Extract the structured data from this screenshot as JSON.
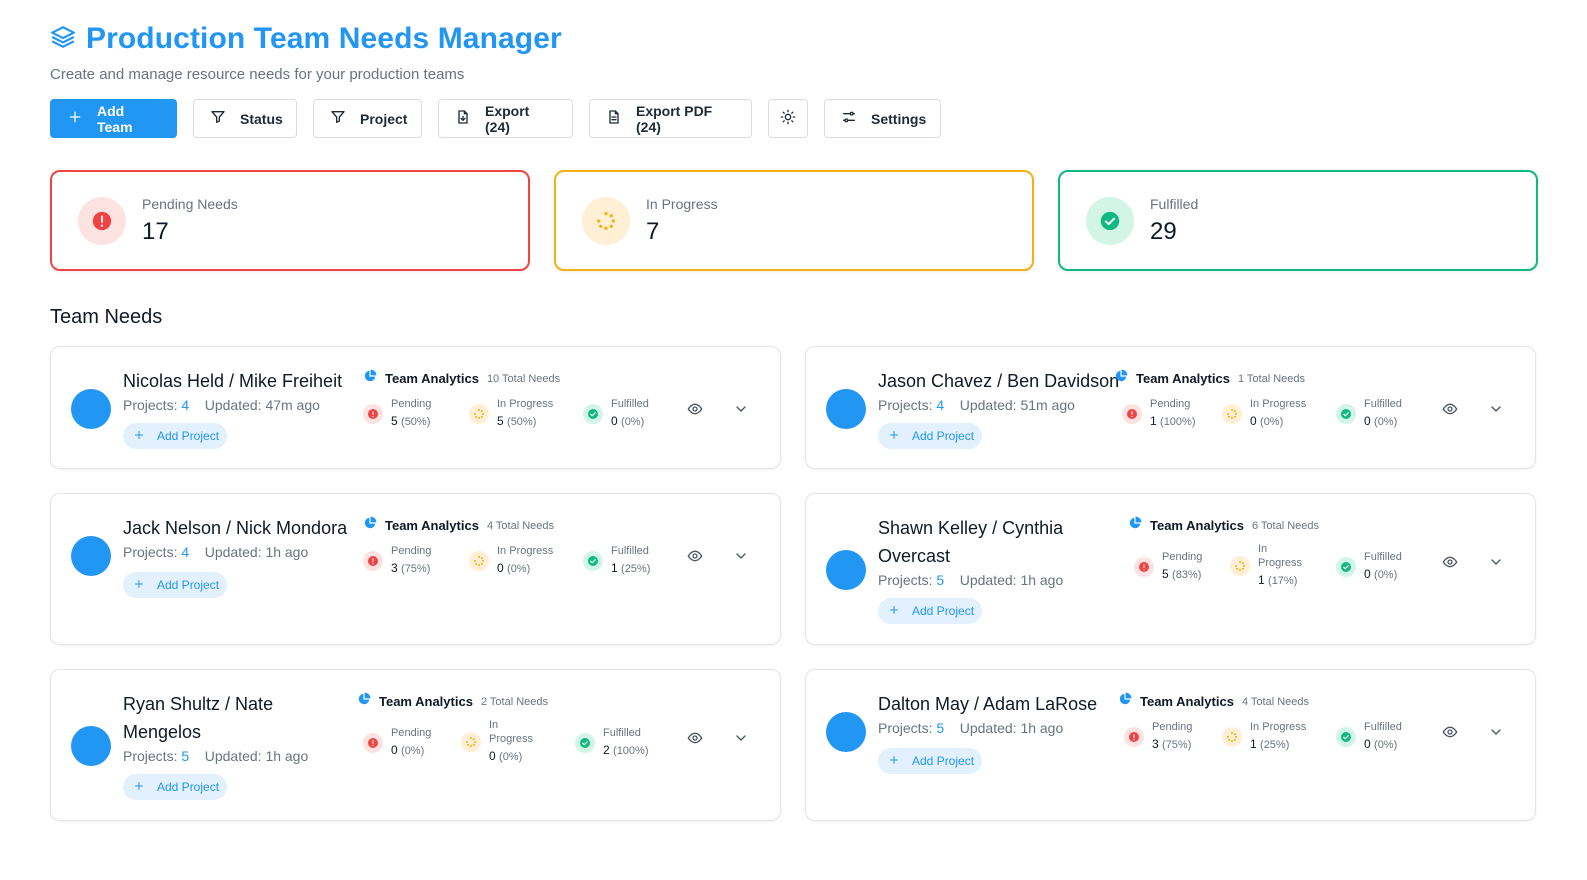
{
  "header": {
    "title": "Production Team Needs Manager",
    "subtitle": "Create and manage resource needs for your production teams"
  },
  "toolbar": {
    "add_team": "Add Team",
    "status": "Status",
    "project": "Project",
    "export": "Export (24)",
    "export_pdf": "Export PDF (24)",
    "settings": "Settings"
  },
  "stats": {
    "pending": {
      "label": "Pending Needs",
      "value": "17"
    },
    "in_progress": {
      "label": "In Progress",
      "value": "7"
    },
    "fulfilled": {
      "label": "Fulfilled",
      "value": "29"
    }
  },
  "section_title": "Team Needs",
  "labels": {
    "projects": "Projects:",
    "updated": "Updated:",
    "add_project": "Add Project",
    "team_analytics": "Team Analytics",
    "pending": "Pending",
    "in_progress": "In Progress",
    "in": "In",
    "progress": "Progress",
    "fulfilled": "Fulfilled"
  },
  "teams": [
    {
      "name": "Nicolas Held / Mike Freiheit",
      "projects": "4",
      "updated": "47m ago",
      "total": "10 Total Needs",
      "pending": "5",
      "pending_pct": "(50%)",
      "in_progress": "5",
      "in_progress_pct": "(50%)",
      "fulfilled": "0",
      "fulfilled_pct": "(0%)"
    },
    {
      "name": "Jason Chavez / Ben Davidson",
      "projects": "4",
      "updated": "51m ago",
      "total": "1 Total Needs",
      "pending": "1",
      "pending_pct": "(100%)",
      "in_progress": "0",
      "in_progress_pct": "(0%)",
      "fulfilled": "0",
      "fulfilled_pct": "(0%)"
    },
    {
      "name": "Jack Nelson / Nick Mondora",
      "projects": "4",
      "updated": "1h ago",
      "total": "4 Total Needs",
      "pending": "3",
      "pending_pct": "(75%)",
      "in_progress": "0",
      "in_progress_pct": "(0%)",
      "fulfilled": "1",
      "fulfilled_pct": "(25%)"
    },
    {
      "name_line1": "Shawn Kelley / Cynthia",
      "name_line2": "Overcast",
      "projects": "5",
      "updated": "1h ago",
      "total": "6 Total Needs",
      "pending": "5",
      "pending_pct": "(83%)",
      "in_progress": "1",
      "in_progress_pct": "(17%)",
      "fulfilled": "0",
      "fulfilled_pct": "(0%)"
    },
    {
      "name_line1": "Ryan Shultz / Nate",
      "name_line2": "Mengelos",
      "projects": "5",
      "updated": "1h ago",
      "total": "2 Total Needs",
      "pending": "0",
      "pending_pct": "(0%)",
      "in_progress": "0",
      "in_progress_pct": "(0%)",
      "fulfilled": "2",
      "fulfilled_pct": "(100%)"
    },
    {
      "name": "Dalton May / Adam LaRose",
      "projects": "5",
      "updated": "1h ago",
      "total": "4 Total Needs",
      "pending": "3",
      "pending_pct": "(75%)",
      "in_progress": "1",
      "in_progress_pct": "(25%)",
      "fulfilled": "0",
      "fulfilled_pct": "(0%)"
    }
  ],
  "colors": {
    "accent": "#2196f3",
    "pending": "#ef4444",
    "in_progress": "#f5b014",
    "fulfilled": "#10b981"
  },
  "icons": [
    "layers-icon",
    "plus-icon",
    "filter-icon",
    "file-export-icon",
    "file-text-icon",
    "sun-icon",
    "sliders-icon",
    "alert-icon",
    "loader-icon",
    "check-circle-icon",
    "pie-chart-icon",
    "eye-icon",
    "chevron-down-icon"
  ]
}
